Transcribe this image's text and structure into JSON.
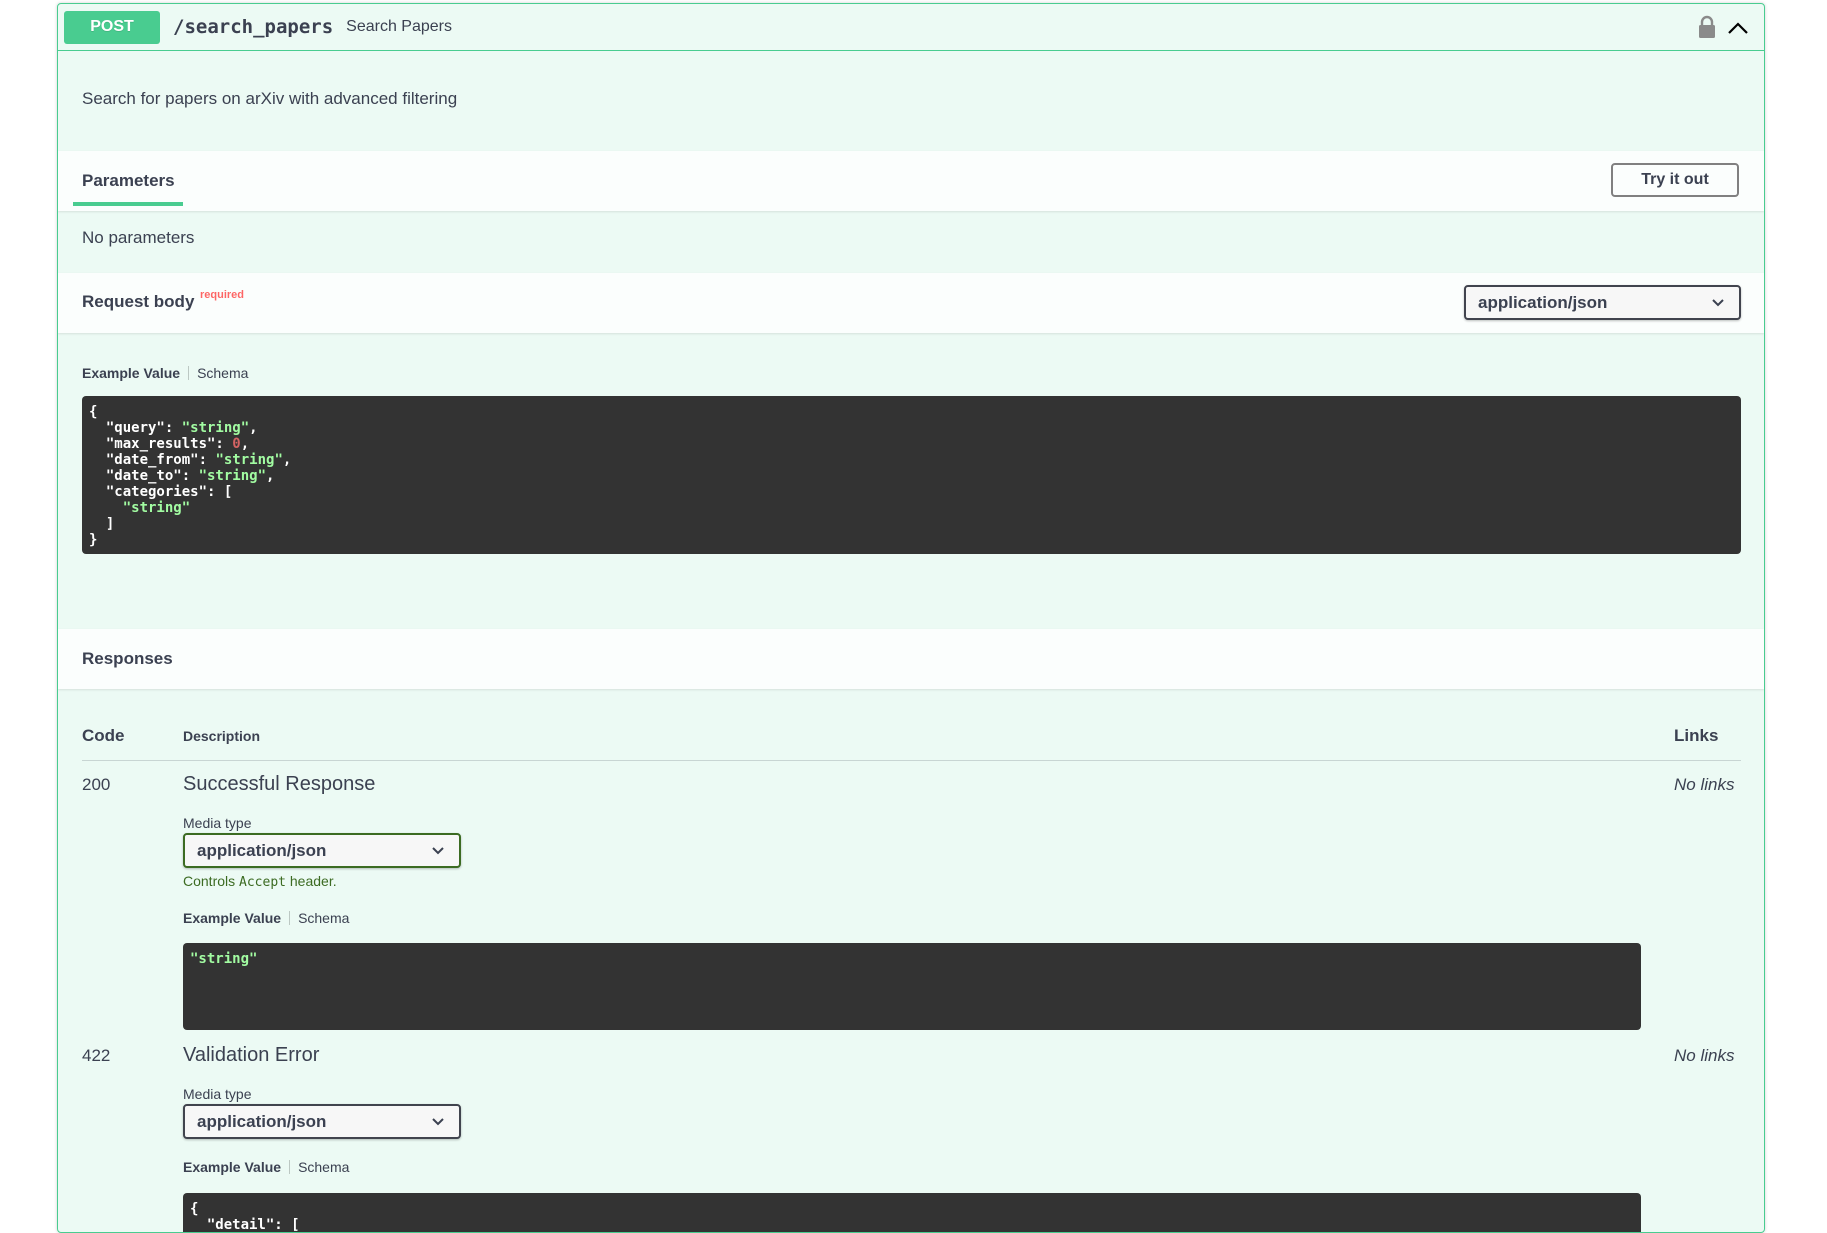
{
  "summary": {
    "method": "POST",
    "path": "/search_papers",
    "description": "Search Papers"
  },
  "operation_description": "Search for papers on arXiv with advanced filtering",
  "parameters": {
    "tab_label": "Parameters",
    "try_button": "Try it out",
    "empty_text": "No parameters"
  },
  "request_body": {
    "title": "Request body",
    "required_label": "required",
    "content_type": "application/json",
    "example_tab": "Example Value",
    "schema_tab": "Schema",
    "example": {
      "line0": "{",
      "line1_key": "  \"query\": ",
      "line1_val": "\"string\"",
      "line1_end": ",",
      "line2_key": "  \"max_results\": ",
      "line2_val": "0",
      "line2_end": ",",
      "line3_key": "  \"date_from\": ",
      "line3_val": "\"string\"",
      "line3_end": ",",
      "line4_key": "  \"date_to\": ",
      "line4_val": "\"string\"",
      "line4_end": ",",
      "line5": "  \"categories\": [",
      "line6_val": "    \"string\"",
      "line7": "  ]",
      "line8": "}"
    }
  },
  "responses": {
    "title": "Responses",
    "col_code": "Code",
    "col_description": "Description",
    "col_links": "Links",
    "items": [
      {
        "code": "200",
        "description": "Successful Response",
        "links": "No links",
        "media_label": "Media type",
        "media_type": "application/json",
        "controls_prefix": "Controls ",
        "controls_code": "Accept",
        "controls_suffix": " header.",
        "example_tab": "Example Value",
        "schema_tab": "Schema",
        "example": "\"string\""
      },
      {
        "code": "422",
        "description": "Validation Error",
        "links": "No links",
        "media_label": "Media type",
        "media_type": "application/json",
        "example_tab": "Example Value",
        "schema_tab": "Schema",
        "example_line0": "{",
        "example_line1": "  \"detail\": ["
      }
    ]
  },
  "colors": {
    "post_green": "#49cc90",
    "code_bg": "#333333",
    "string_green": "#a2fca2",
    "number_red": "#d36363",
    "required_red": "rgba(255,0,0,0.6)"
  }
}
